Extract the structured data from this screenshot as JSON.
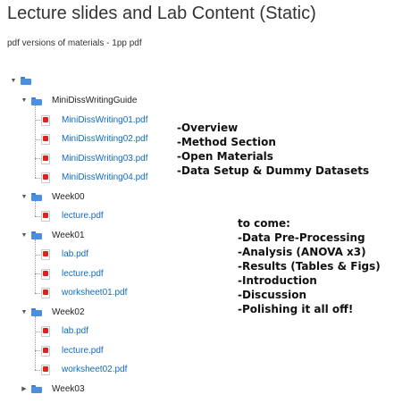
{
  "page": {
    "title": "Lecture slides and Lab Content (Static)",
    "subtitle": "pdf versions of materials - 1pp pdf"
  },
  "tree": {
    "root": {
      "expanded": true,
      "label": ""
    },
    "folders": [
      {
        "label": "MiniDissWritingGuide",
        "expanded": true,
        "files": [
          "MiniDissWriting01.pdf",
          "MiniDissWriting02.pdf",
          "MiniDissWriting03.pdf",
          "MiniDissWriting04.pdf"
        ]
      },
      {
        "label": "Week00",
        "expanded": true,
        "files": [
          "lecture.pdf"
        ]
      },
      {
        "label": "Week01",
        "expanded": true,
        "files": [
          "lab.pdf",
          "lecture.pdf",
          "worksheet01.pdf"
        ]
      },
      {
        "label": "Week02",
        "expanded": true,
        "files": [
          "lab.pdf",
          "lecture.pdf",
          "worksheet02.pdf"
        ]
      },
      {
        "label": "Week03",
        "expanded": false,
        "files": []
      }
    ]
  },
  "annotations": {
    "done": [
      "-Overview",
      "-Method Section",
      "-Open Materials",
      "-Data Setup & Dummy Datasets"
    ],
    "to_come": [
      "to come:",
      "-Data Pre-Processing",
      "-Analysis (ANOVA x3)",
      "-Results (Tables & Figs)",
      "-Introduction",
      "-Discussion",
      "-Polishing it all off!"
    ]
  },
  "colors": {
    "link": "#0f6cbf",
    "folder": "#4a8fe0",
    "pdf": "#d9251c"
  },
  "icons": {
    "folder": "folder-icon",
    "pdf": "pdf-file-icon",
    "expanded": "chevron-down-icon",
    "collapsed": "chevron-right-icon"
  }
}
